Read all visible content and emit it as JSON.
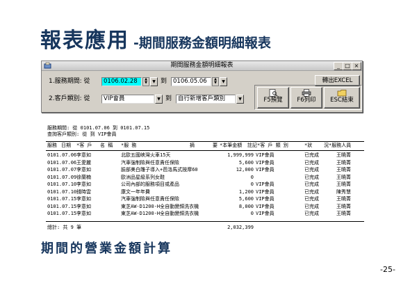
{
  "slide": {
    "title_main": "報表應用",
    "title_sub": "-期間服務金額明細報表",
    "caption": "期間的營業金額計算",
    "page_number": "-25-"
  },
  "window": {
    "title": "期間服務金額明細報表",
    "minimize": "_",
    "maximize": "□",
    "close": "×",
    "row1_label": "1.服務期間: 從",
    "from_date": "0106.02.28",
    "to_label": "到",
    "to_date": "0106.05.06",
    "export_button": "轉出EXCEL",
    "row2_label": "2.客戶類別: 從",
    "from_category": "VIP會員",
    "to_label2": "到",
    "to_category": "自行新增客戶類別",
    "preview_button": "F5預覽",
    "print_button": "F6列印",
    "exit_button": "ESC結束"
  },
  "report": {
    "period_line": "服務期間: 從  0101.07.06  到  0101.07.15",
    "category_line": "查詢客戶類別: 從                  到  VIP會員",
    "headers": {
      "type": "服務",
      "date": "日期",
      "cust": "*客  戶",
      "name": "名  稱",
      "service": "*服     務",
      "item": "摘",
      "summary": "要",
      "amount": "*本筆金額",
      "cust_type": "註記*客 戶   類 別",
      "status": "*狀",
      "staff": "況*服務人員"
    },
    "rows": [
      {
        "date": "0101.07.06",
        "cust": "李意如",
        "service": "北歐五國峽灣火車15天",
        "amount": "1,999,999",
        "category": "VIP會員",
        "status": "已完成",
        "staff": "王曉菁"
      },
      {
        "date": "0101.07.06",
        "cust": "王愛麗",
        "service": "汽車強制險與任意責任保險",
        "amount": "5,600",
        "category": "VIP會員",
        "status": "已完成",
        "staff": "王曉菁"
      },
      {
        "date": "0101.07.07",
        "cust": "李意如",
        "service": "臉部美白雕子導入+芭洛馬式按摩60",
        "amount": "12,000",
        "category": "VIP會員",
        "status": "已完成",
        "staff": "王曉菁"
      },
      {
        "date": "0101.07.09",
        "cust": "徐蘭楠",
        "service": "歐洲品星級系列女鞋",
        "amount": "0",
        "category": "",
        "status": "已完成",
        "staff": "王曉菁"
      },
      {
        "date": "0101.07.10",
        "cust": "李意如",
        "service": "公司內部的服務項目或產品",
        "amount": "0",
        "category": "VIP會員",
        "status": "已完成",
        "staff": "王曉菁"
      },
      {
        "date": "0101.07.10",
        "cust": "錢時雲",
        "service": "康文一年年費",
        "amount": "1,200",
        "category": "VIP會員",
        "status": "已完成",
        "staff": "陳秀慧"
      },
      {
        "date": "0101.07.15",
        "cust": "李意如",
        "service": "汽車強制險與任意責任保險",
        "amount": "5,600",
        "category": "VIP會員",
        "status": "已完成",
        "staff": "王曉菁"
      },
      {
        "date": "0101.07.15",
        "cust": "李意如",
        "service": "東芝AW-D1200-H全自動變頻洗衣機",
        "amount": "8,000",
        "category": "VIP會員",
        "status": "已完成",
        "staff": "王曉菁"
      },
      {
        "date": "0101.07.15",
        "cust": "李意如",
        "service": "東芝AW-D1200-H全自動變頻洗衣機",
        "amount": "0",
        "category": "VIP會員",
        "status": "已完成",
        "staff": "王曉菁"
      }
    ],
    "total_label": "總計: 共 9 筆",
    "total_amount": "2,032,399"
  }
}
